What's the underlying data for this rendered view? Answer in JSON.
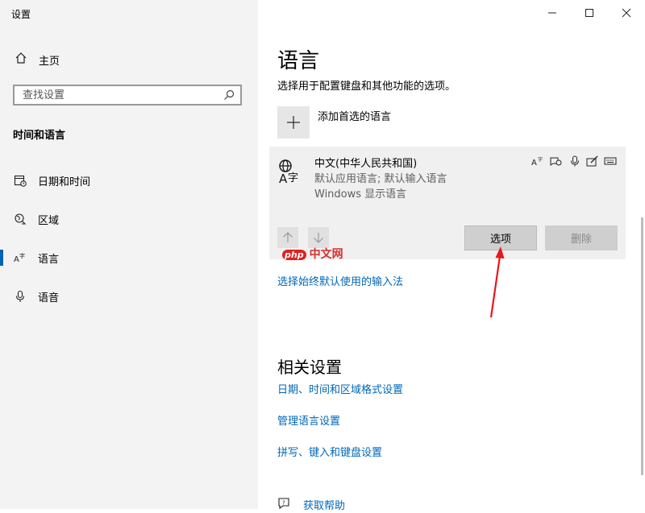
{
  "window": {
    "title": "设置"
  },
  "sidebar": {
    "home_label": "主页",
    "search_placeholder": "查找设置",
    "section_title": "时间和语言",
    "items": [
      {
        "label": "日期和时间",
        "icon": "date-time-icon"
      },
      {
        "label": "区域",
        "icon": "region-icon"
      },
      {
        "label": "语言",
        "icon": "language-icon",
        "active": true
      },
      {
        "label": "语音",
        "icon": "microphone-icon"
      }
    ]
  },
  "main": {
    "title": "语言",
    "subtitle": "选择用于配置键盘和其他功能的选项。",
    "add_language_label": "添加首选的语言",
    "language": {
      "name": "中文(中华人民共和国)",
      "detail1": "默认应用语言; 默认输入语言",
      "detail2": "Windows 显示语言",
      "icon_text": "A字"
    },
    "options_button": "选项",
    "remove_button": "删除",
    "input_method_link": "选择始终默认使用的输入法",
    "related_title": "相关设置",
    "related_links": [
      "日期、时间和区域格式设置",
      "管理语言设置",
      "拼写、键入和键盘设置"
    ],
    "help_link": "获取帮助"
  },
  "watermark": {
    "brand": "php",
    "text": "中文网"
  },
  "colors": {
    "accent": "#0063b1",
    "link": "#0067b8",
    "arrow": "#e8161b"
  }
}
